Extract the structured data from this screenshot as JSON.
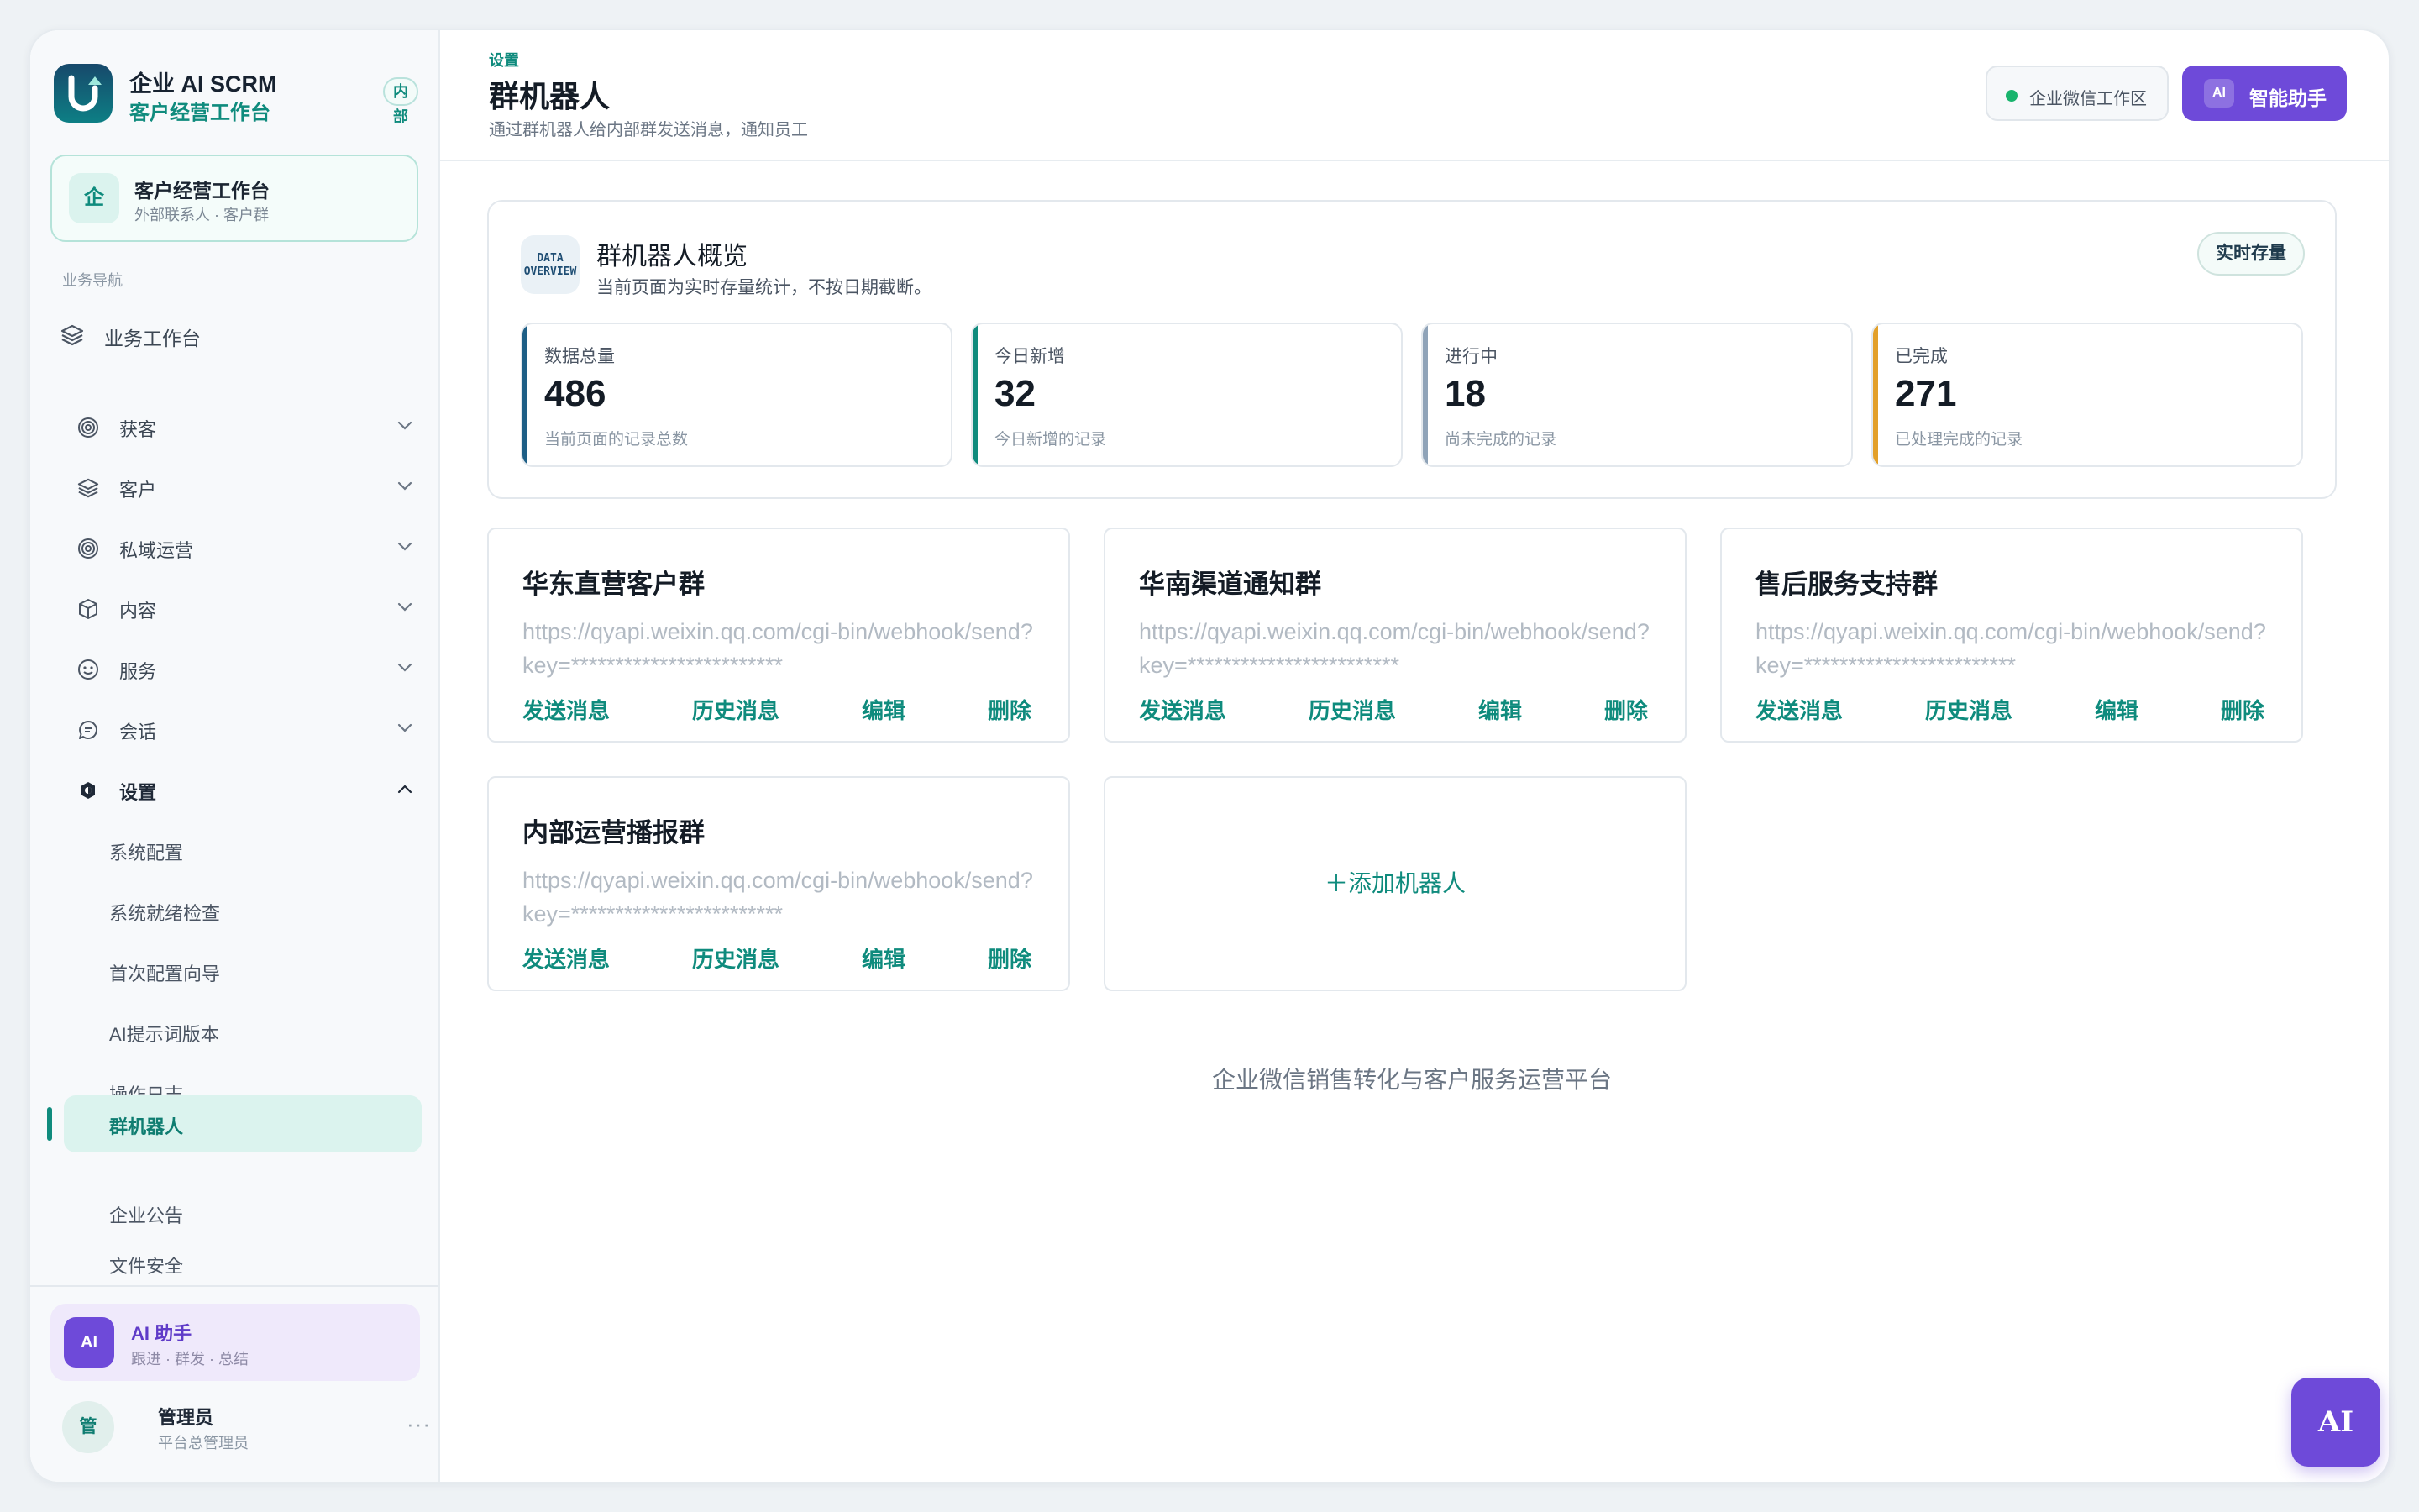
{
  "brand": {
    "title": "企业 AI SCRM",
    "subtitle": "客户经营工作台",
    "badge": "内部"
  },
  "workspace": {
    "icon_text": "企",
    "title": "客户经营工作台",
    "subtitle": "外部联系人 · 客户群"
  },
  "nav": {
    "section_label": "业务导航",
    "top_item": "业务工作台",
    "groups": [
      {
        "label": "获客",
        "icon": "target-icon"
      },
      {
        "label": "客户",
        "icon": "layers-icon"
      },
      {
        "label": "私域运营",
        "icon": "target-icon"
      },
      {
        "label": "内容",
        "icon": "box-icon"
      },
      {
        "label": "服务",
        "icon": "smile-icon"
      },
      {
        "label": "会话",
        "icon": "chat-icon"
      },
      {
        "label": "设置",
        "icon": "settings-icon"
      }
    ],
    "settings_items": [
      "系统配置",
      "系统就绪检查",
      "首次配置向导",
      "AI提示词版本",
      "操作日志",
      "群机器人",
      "企业公告",
      "文件安全"
    ],
    "active_item": "群机器人"
  },
  "ai_card": {
    "badge": "AI",
    "title": "AI 助手",
    "subtitle": "跟进 · 群发 · 总结"
  },
  "user": {
    "avatar": "管",
    "name": "管理员",
    "role": "平台总管理员",
    "more": "···"
  },
  "header": {
    "breadcrumb": "设置",
    "title": "群机器人",
    "description": "通过群机器人给内部群发送消息，通知员工",
    "env_label": "企业微信工作区",
    "ai_button_icon": "AI",
    "ai_button_label": "智能助手"
  },
  "overview": {
    "icon_line1": "DATA",
    "icon_line2": "OVERVIEW",
    "title": "群机器人概览",
    "subtitle": "当前页面为实时存量统计，不按日期截断。",
    "pill": "实时存量",
    "stats": [
      {
        "label": "数据总量",
        "value": "486",
        "sub": "当前页面的记录总数",
        "color": "#1e5f86"
      },
      {
        "label": "今日新增",
        "value": "32",
        "sub": "今日新增的记录",
        "color": "#0f8b7d"
      },
      {
        "label": "进行中",
        "value": "18",
        "sub": "尚未完成的记录",
        "color": "#8fa3b8"
      },
      {
        "label": "已完成",
        "value": "271",
        "sub": "已处理完成的记录",
        "color": "#e3a02a"
      }
    ]
  },
  "robots": [
    {
      "name": "华东直营客户群",
      "url": "https://qyapi.weixin.qq.com/cgi-bin/webhook/send?key=************************"
    },
    {
      "name": "华南渠道通知群",
      "url": "https://qyapi.weixin.qq.com/cgi-bin/webhook/send?key=************************"
    },
    {
      "name": "售后服务支持群",
      "url": "https://qyapi.weixin.qq.com/cgi-bin/webhook/send?key=************************"
    },
    {
      "name": "内部运营播报群",
      "url": "https://qyapi.weixin.qq.com/cgi-bin/webhook/send?key=************************"
    }
  ],
  "robot_actions": {
    "send": "发送消息",
    "history": "历史消息",
    "edit": "编辑",
    "delete": "删除"
  },
  "add_robot": "＋添加机器人",
  "footer_note": "企业微信销售转化与客户服务运营平台",
  "fab_label": "AI",
  "colors": {
    "accent": "#0f8b7d",
    "ai_purple": "#6e4ad9"
  }
}
